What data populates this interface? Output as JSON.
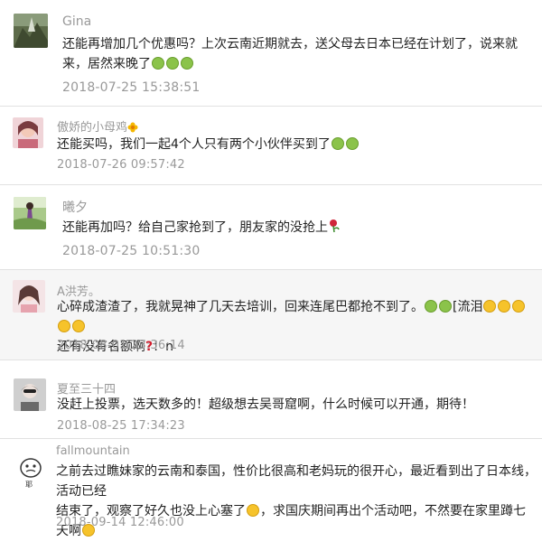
{
  "comments": [
    {
      "name": "Gina",
      "text": "还能再增加几个优惠吗？上次云南近期就去，送父母去日本已经在计划了，说来就来，居然来晚了",
      "time": "2018-07-25 15:38:51",
      "emojis": [
        "grin-green",
        "grin-green",
        "grin-green"
      ]
    },
    {
      "name": "傲娇的小母鸡",
      "name_badge": "flower-icon",
      "text": "还能买吗，我们一起4个人只有两个小伙伴买到了",
      "time": "2018-07-26 09:57:42",
      "emojis": [
        "grin-green",
        "grin-green"
      ]
    },
    {
      "name": "曦夕",
      "text": "还能再加吗？给自己家抢到了，朋友家的没抢上",
      "time": "2018-07-25 10:51:30",
      "emojis": [
        "rose-icon"
      ]
    },
    {
      "name": "A洪芳。",
      "text_line1": "心碎成渣渣了，我就晃神了几天去培训，回来连尾巴都抢不到了。",
      "text_mid": "[流泪",
      "text_line2a": "还有没有名额啊",
      "text_line2b": "！n",
      "time": "2018-08-01 23:36:14",
      "emojis_a": [
        "grin-green",
        "grin-green"
      ],
      "emojis_b": [
        "sad-yellow",
        "sad-yellow",
        "sad-yellow",
        "sad-yellow",
        "sad-yellow"
      ],
      "mark": "question-icon"
    },
    {
      "name": "夏至三十四",
      "text": "没赶上投票，选天数多的！超级想去吴哥窟啊，什么时候可以开通，期待！",
      "time": "2018-08-25 17:34:23"
    },
    {
      "name": "fallmountain",
      "text_line1": "之前去过瞧妹家的云南和泰国，性价比很高和老妈玩的很开心，最近看到出了日本线，活动已经",
      "text_line2a": "结束了，观察了好久也没上心塞了",
      "text_line2b": "，求国庆期间再出个活动吧，不然要在家里蹲七天啊",
      "time": "2018-09-14 12:46:00",
      "emojis": [
        "sad-yellow",
        "sweat-yellow"
      ]
    }
  ],
  "colors": {
    "name": "#999999",
    "text": "#222222",
    "time": "#999999",
    "alt_bg": "#f6f6f6"
  }
}
